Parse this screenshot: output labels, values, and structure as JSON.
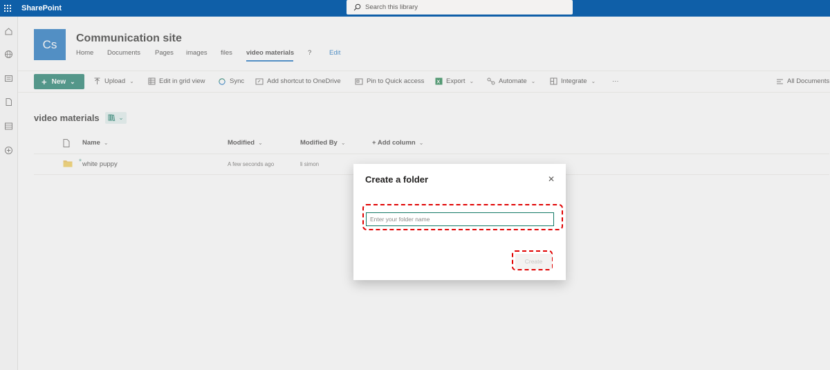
{
  "suitebar": {
    "app_name": "SharePoint",
    "search_placeholder": "Search this library"
  },
  "site": {
    "logo_initials": "Cs",
    "title": "Communication site",
    "nav": [
      {
        "label": "Home"
      },
      {
        "label": "Documents"
      },
      {
        "label": "Pages"
      },
      {
        "label": "images"
      },
      {
        "label": "files"
      },
      {
        "label": "video materials",
        "active": true
      },
      {
        "label": "?"
      },
      {
        "label": "Edit"
      }
    ]
  },
  "commands": {
    "new": "New",
    "upload": "Upload",
    "edit_grid": "Edit in grid view",
    "sync": "Sync",
    "add_shortcut": "Add shortcut to OneDrive",
    "pin": "Pin to Quick access",
    "export": "Export",
    "automate": "Automate",
    "integrate": "Integrate",
    "more": "···",
    "all_documents": "All Documents"
  },
  "library": {
    "title": "video materials",
    "columns": {
      "name": "Name",
      "modified": "Modified",
      "modified_by": "Modified By",
      "add_column": "+ Add column"
    },
    "rows": [
      {
        "name": "white puppy",
        "modified": "A few seconds ago",
        "modified_by": "li simon"
      }
    ]
  },
  "dialog": {
    "title": "Create a folder",
    "input_placeholder": "Enter your folder name",
    "create_label": "Create"
  },
  "colors": {
    "suitebar": "#0f5fa8",
    "accent": "#117865",
    "highlight": "#e00000"
  }
}
